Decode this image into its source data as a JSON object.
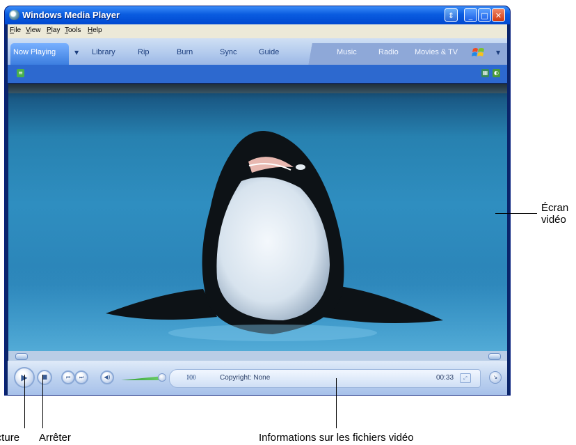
{
  "window": {
    "title": "Windows Media Player",
    "menus": [
      "File",
      "View",
      "Play",
      "Tools",
      "Help"
    ],
    "tabs": [
      "Now Playing",
      "Library",
      "Rip",
      "Burn",
      "Sync",
      "Guide"
    ],
    "right_tabs": [
      "Music",
      "Radio",
      "Movies & TV"
    ],
    "active_tab": "Now Playing"
  },
  "player": {
    "info_text": "Copyright: None",
    "time": "00:33",
    "seek_fraction": 0.02,
    "volume_fraction": 0.9
  },
  "callouts": {
    "play_label": "Lecture",
    "stop_label": "Arrêter",
    "info_label": "Informations sur les fichiers vidéo",
    "screen_line1": "Écran",
    "screen_line2": "vidéo"
  },
  "icons": [
    "app-icon",
    "mode-switch-icon",
    "minimize-icon",
    "maximize-icon",
    "close-icon",
    "playlist-icon",
    "visualization-icon",
    "play-icon",
    "stop-icon",
    "previous-icon",
    "next-icon",
    "mute-icon",
    "eq-icon",
    "fullscreen-icon",
    "compact-mode-icon",
    "windows-logo-icon"
  ]
}
